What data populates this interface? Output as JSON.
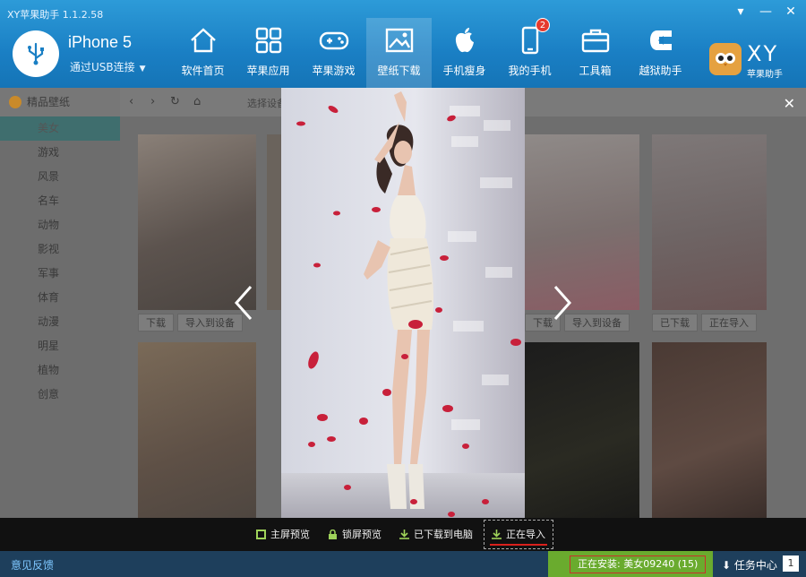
{
  "app": {
    "title": "XY苹果助手 1.1.2.58"
  },
  "device": {
    "name": "iPhone 5",
    "connection": "通过USB连接"
  },
  "nav": [
    {
      "label": "软件首页",
      "icon": "home-icon"
    },
    {
      "label": "苹果应用",
      "icon": "apps-grid-icon"
    },
    {
      "label": "苹果游戏",
      "icon": "gamepad-icon"
    },
    {
      "label": "壁纸下载",
      "icon": "picture-icon",
      "active": true
    },
    {
      "label": "手机瘦身",
      "icon": "apple-icon"
    },
    {
      "label": "我的手机",
      "icon": "phone-icon",
      "badge": "2"
    },
    {
      "label": "工具箱",
      "icon": "toolbox-icon"
    },
    {
      "label": "越狱助手",
      "icon": "jailbreak-icon"
    }
  ],
  "brand": {
    "name": "XY",
    "subtitle": "苹果助手"
  },
  "sidebar": {
    "header": "精品壁纸",
    "items": [
      "美女",
      "游戏",
      "风景",
      "名车",
      "动物",
      "影视",
      "军事",
      "体育",
      "动漫",
      "明星",
      "植物",
      "创意"
    ],
    "active_index": 0
  },
  "toolbar": {
    "crumb": "选择设备"
  },
  "thumb_actions": {
    "download": "下载",
    "import": "导入到设备",
    "downloaded": "已下载",
    "importing": "正在导入"
  },
  "actionbar": {
    "fullscreen": "主屏预览",
    "lockscreen": "锁屏预览",
    "downloaded_to_pc": "已下载到电脑",
    "importing": "正在导入"
  },
  "statusbar": {
    "feedback": "意见反馈",
    "installing": "正在安装: 美女09240 (15)",
    "task_center": "任务中心",
    "task_count": "1"
  },
  "colors": {
    "header_blue": "#1a7fc4",
    "status_blue": "#1e3f5c",
    "install_green": "#6aab2e",
    "badge_red": "#e53a2e"
  }
}
